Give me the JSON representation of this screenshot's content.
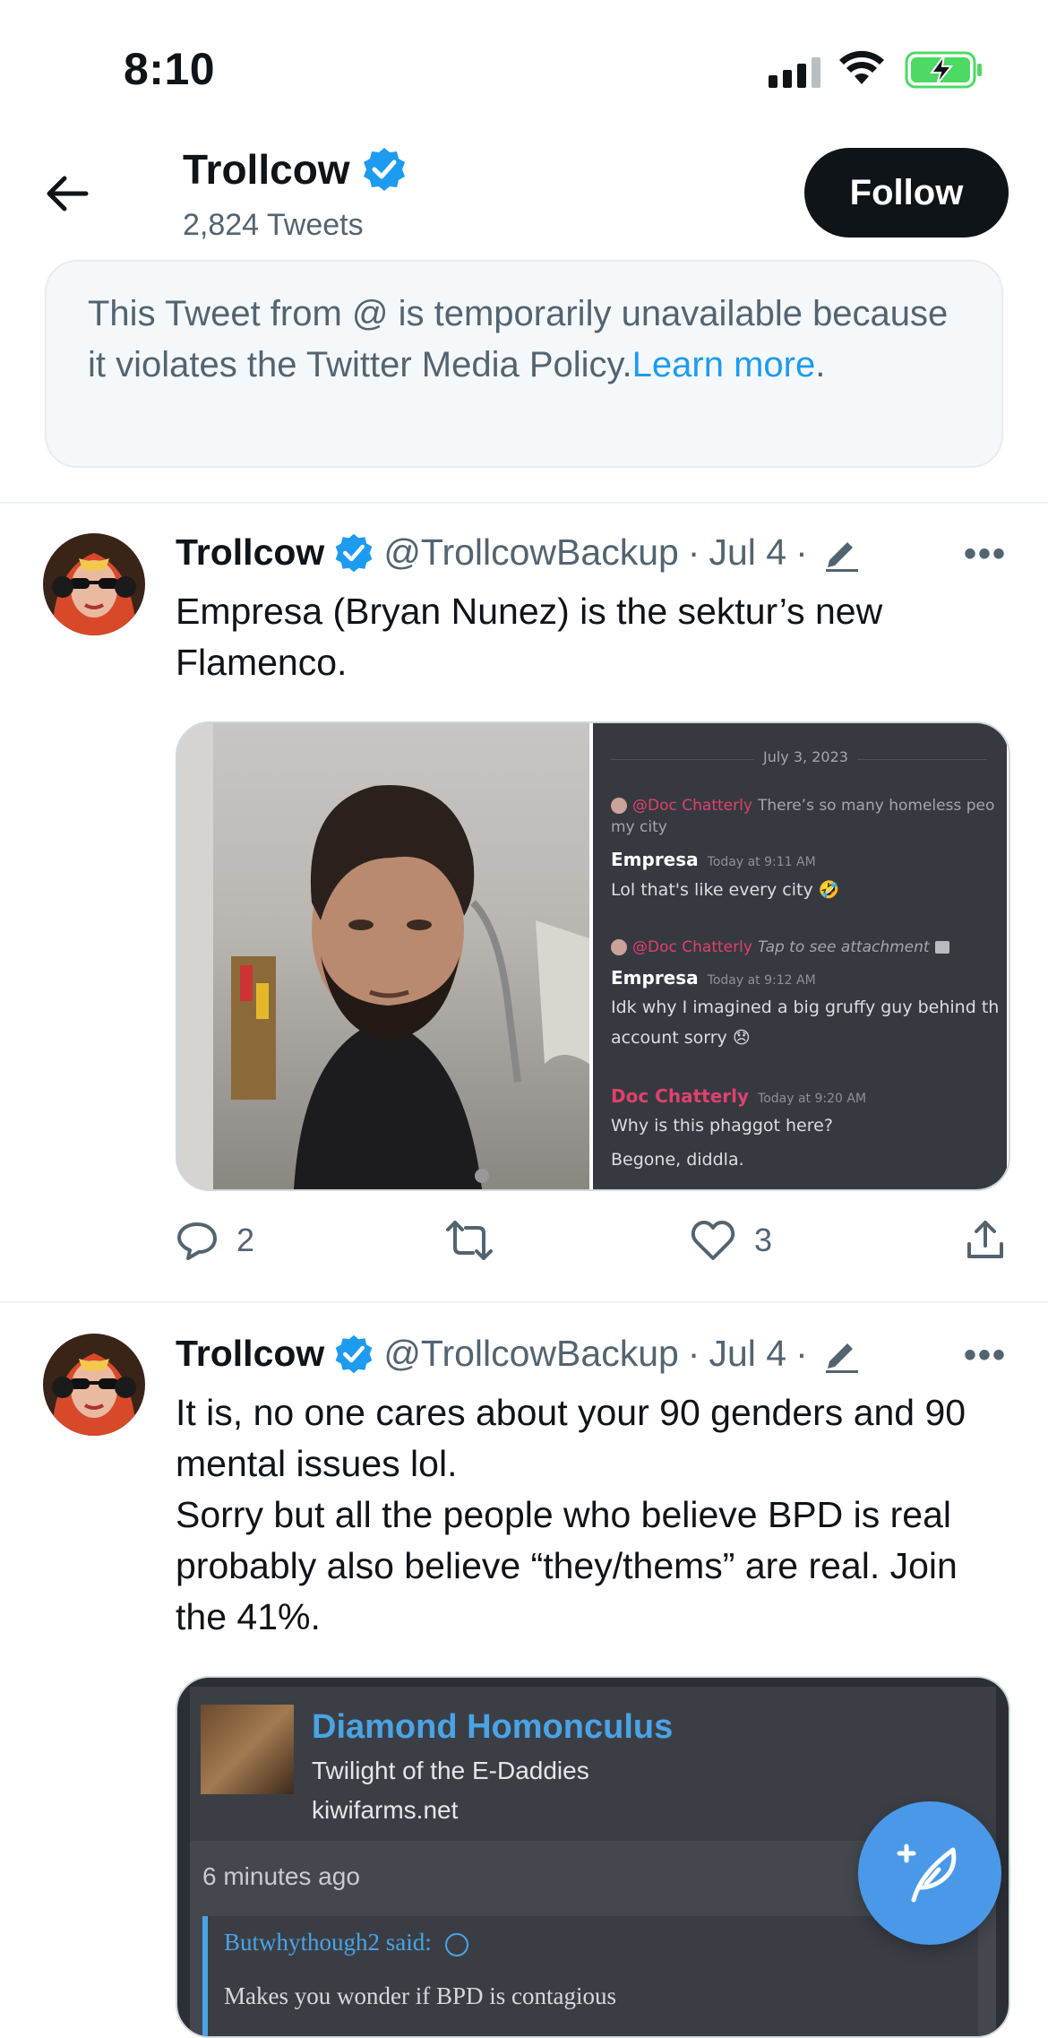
{
  "status_bar": {
    "time": "8:10"
  },
  "header": {
    "title": "Trollcow",
    "tweet_count": "2,824 Tweets",
    "follow_label": "Follow"
  },
  "notice": {
    "text": "This Tweet from @ is temporarily unavailable because it violates the Twitter Media Policy.",
    "link": "Learn more",
    "period": "."
  },
  "tweets": [
    {
      "name": "Trollcow",
      "handle": "@TrollcowBackup",
      "date": "Jul 4",
      "text": "Empresa (Bryan Nunez) is the sektur’s new Flamenco.",
      "media": {
        "discord": {
          "date_divider": "July 3, 2023",
          "messages": [
            {
              "reply_to": "@Doc Chatterly",
              "reply_text": "There’s so many homeless peo",
              "reply_text_wrap": "my city",
              "author": "Empresa",
              "time": "Today at 9:11 AM",
              "lines": [
                "Lol that's like every city 🤣"
              ]
            },
            {
              "reply_to": "@Doc Chatterly",
              "reply_text": "Tap to see attachment",
              "author": "Empresa",
              "time": "Today at 9:12 AM",
              "lines": [
                "Idk why I imagined a big gruffy guy behind th",
                "account sorry 😞"
              ]
            },
            {
              "author": "Doc Chatterly",
              "time": "Today at 9:20 AM",
              "lines": [
                "Why is this phaggot here?",
                "Begone, diddla."
              ]
            }
          ]
        }
      },
      "replies": "2",
      "retweets": "",
      "likes": "3"
    },
    {
      "name": "Trollcow",
      "handle": "@TrollcowBackup",
      "date": "Jul 4",
      "text": "It is, no one cares about your 90 genders and 90 mental issues lol.\nSorry but all the people who believe BPD is real probably also believe “they/thems” are real. Join the 41%.",
      "card": {
        "title": "Diamond Homonculus",
        "subtitle": "Twilight of the E-Daddies",
        "domain": "kiwifarms.net",
        "time_ago": "6 minutes ago",
        "quote_author": "Butwhythough2 said:",
        "quote_text": "Makes you wonder if BPD is contagious"
      }
    }
  ],
  "colors": {
    "accent": "#1d9bf0",
    "verified": "#1d9bf0",
    "fab": "#4a99e9"
  }
}
